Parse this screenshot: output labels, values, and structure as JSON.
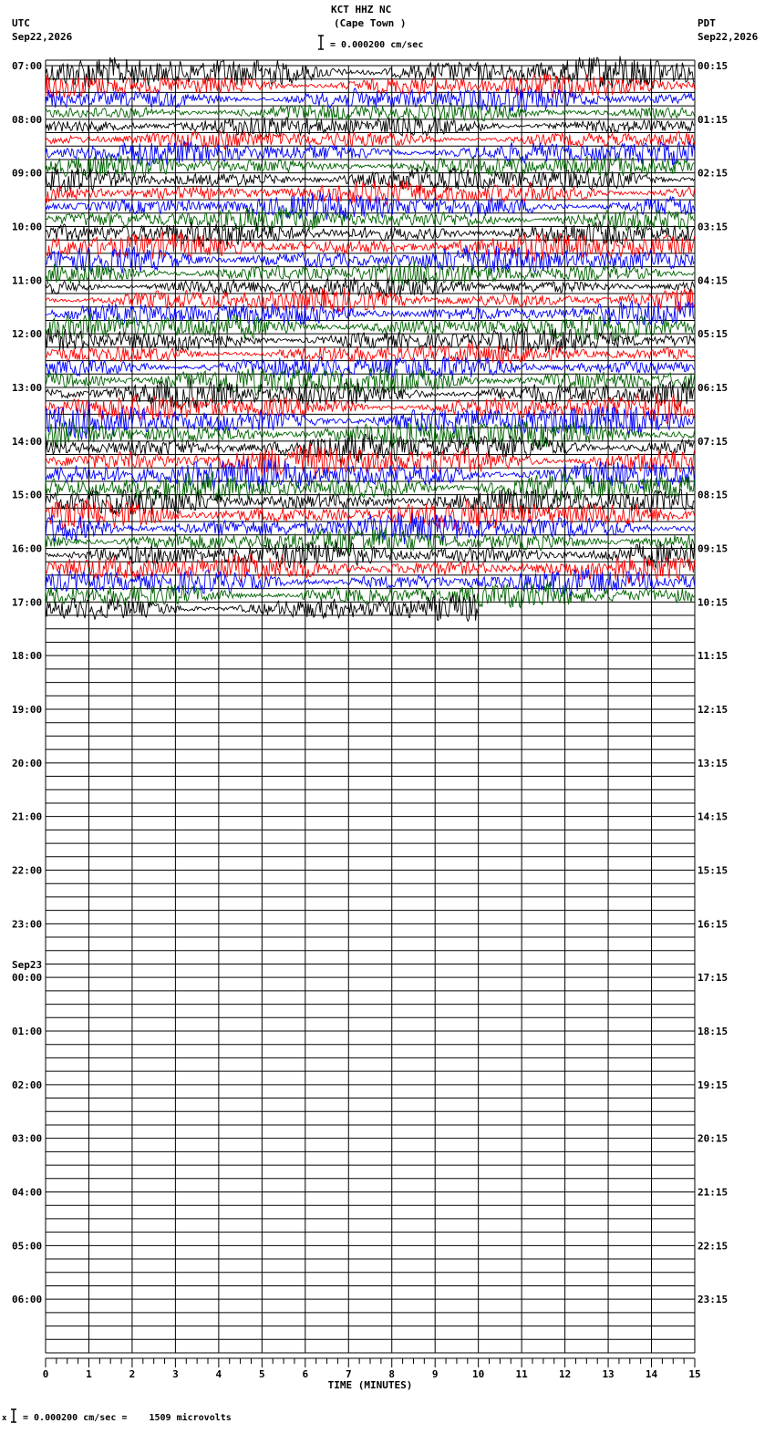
{
  "header": {
    "station": "KCT HHZ NC",
    "location": "(Cape Town )",
    "scale_text": "= 0.000200 cm/sec",
    "left_tz": "UTC",
    "left_date": "Sep22,2026",
    "right_tz": "PDT",
    "right_date": "Sep22,2026"
  },
  "footer": {
    "scale_text": "= 0.000200 cm/sec =    1509 microvolts"
  },
  "colors": {
    "traces": [
      "#000000",
      "#ff0000",
      "#0000ff",
      "#006400"
    ],
    "grid": "#000000",
    "background": "#ffffff"
  },
  "chart_data": {
    "type": "line",
    "subtype": "helicorder",
    "xlabel": "TIME (MINUTES)",
    "xlim": [
      0,
      15
    ],
    "x_ticks": [
      "0",
      "1",
      "2",
      "3",
      "4",
      "5",
      "6",
      "7",
      "8",
      "9",
      "10",
      "11",
      "12",
      "13",
      "14",
      "15"
    ],
    "traces_per_hour": 4,
    "hours": 24,
    "left_labels": [
      {
        "row": 0,
        "text": "07:00"
      },
      {
        "row": 4,
        "text": "08:00"
      },
      {
        "row": 8,
        "text": "09:00"
      },
      {
        "row": 12,
        "text": "10:00"
      },
      {
        "row": 16,
        "text": "11:00"
      },
      {
        "row": 20,
        "text": "12:00"
      },
      {
        "row": 24,
        "text": "13:00"
      },
      {
        "row": 28,
        "text": "14:00"
      },
      {
        "row": 32,
        "text": "15:00"
      },
      {
        "row": 36,
        "text": "16:00"
      },
      {
        "row": 40,
        "text": "17:00"
      },
      {
        "row": 44,
        "text": "18:00"
      },
      {
        "row": 48,
        "text": "19:00"
      },
      {
        "row": 52,
        "text": "20:00"
      },
      {
        "row": 56,
        "text": "21:00"
      },
      {
        "row": 60,
        "text": "22:00"
      },
      {
        "row": 64,
        "text": "23:00"
      },
      {
        "row": 68,
        "text": "00:00",
        "date": "Sep23"
      },
      {
        "row": 72,
        "text": "01:00"
      },
      {
        "row": 76,
        "text": "02:00"
      },
      {
        "row": 80,
        "text": "03:00"
      },
      {
        "row": 84,
        "text": "04:00"
      },
      {
        "row": 88,
        "text": "05:00"
      },
      {
        "row": 92,
        "text": "06:00"
      }
    ],
    "right_labels": [
      {
        "row": 0,
        "text": "00:15"
      },
      {
        "row": 4,
        "text": "01:15"
      },
      {
        "row": 8,
        "text": "02:15"
      },
      {
        "row": 12,
        "text": "03:15"
      },
      {
        "row": 16,
        "text": "04:15"
      },
      {
        "row": 20,
        "text": "05:15"
      },
      {
        "row": 24,
        "text": "06:15"
      },
      {
        "row": 28,
        "text": "07:15"
      },
      {
        "row": 32,
        "text": "08:15"
      },
      {
        "row": 36,
        "text": "09:15"
      },
      {
        "row": 40,
        "text": "10:15"
      },
      {
        "row": 44,
        "text": "11:15"
      },
      {
        "row": 48,
        "text": "12:15"
      },
      {
        "row": 52,
        "text": "13:15"
      },
      {
        "row": 56,
        "text": "14:15"
      },
      {
        "row": 60,
        "text": "15:15"
      },
      {
        "row": 64,
        "text": "16:15"
      },
      {
        "row": 68,
        "text": "17:15"
      },
      {
        "row": 72,
        "text": "18:15"
      },
      {
        "row": 76,
        "text": "19:15"
      },
      {
        "row": 80,
        "text": "20:15"
      },
      {
        "row": 84,
        "text": "21:15"
      },
      {
        "row": 88,
        "text": "22:15"
      },
      {
        "row": 92,
        "text": "23:15"
      }
    ],
    "filled_rows": 41,
    "last_row_end_minute": 10,
    "row_amplitude": [
      1.2,
      0.9,
      0.9,
      0.7,
      0.8,
      0.7,
      0.9,
      0.8,
      0.9,
      0.9,
      1.0,
      0.9,
      0.9,
      1.0,
      1.0,
      0.9,
      0.8,
      0.9,
      0.9,
      1.0,
      0.9,
      0.8,
      0.9,
      1.1,
      1.1,
      1.0,
      1.2,
      1.1,
      1.1,
      1.2,
      1.2,
      1.1,
      1.0,
      1.1,
      1.1,
      1.0,
      1.0,
      1.0,
      0.9,
      0.9,
      1.0
    ]
  }
}
